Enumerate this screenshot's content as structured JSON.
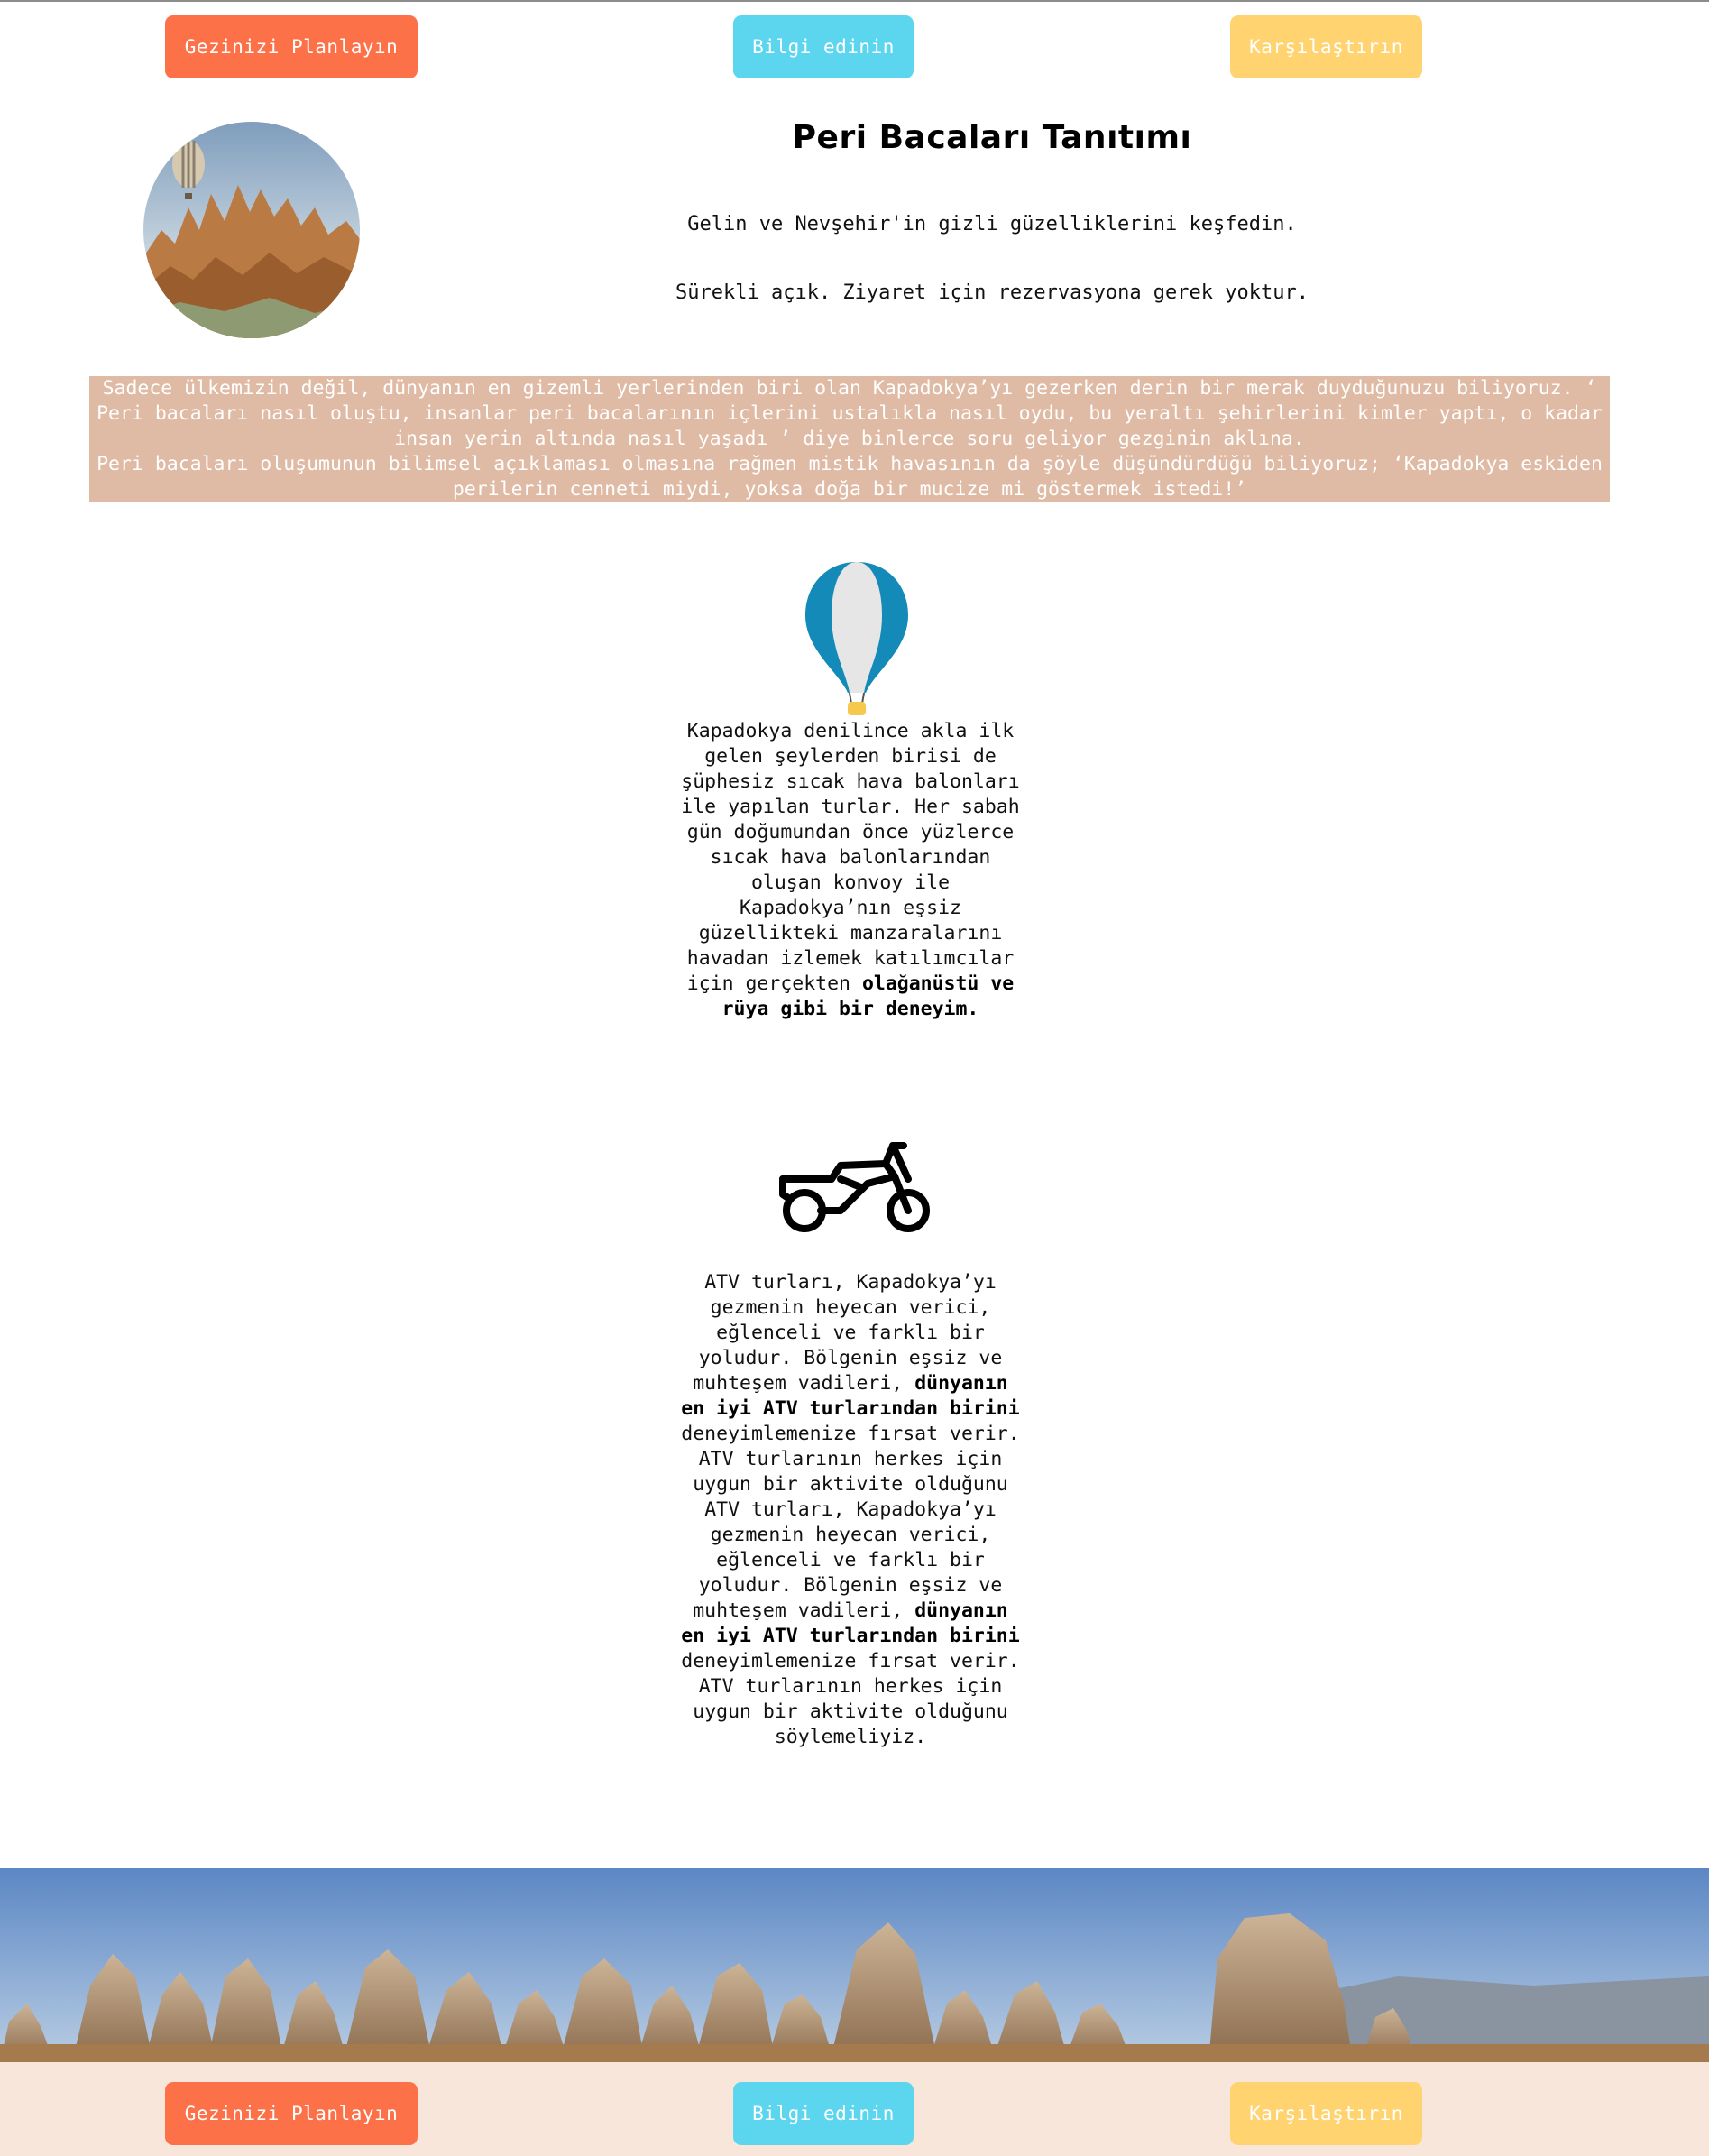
{
  "nav": {
    "plan_label": "Gezinizi Planlayın",
    "info_label": "Bilgi edinin",
    "compare_label": "Karşılaştırın"
  },
  "header": {
    "title": "Peri Bacaları Tanıtımı",
    "subtitle_1": "Gelin ve Nevşehir'in gizli güzelliklerini keşfedin.",
    "subtitle_2": "Sürekli açık. Ziyaret için rezervasyona gerek yoktur."
  },
  "intro": {
    "paragraph_1": "Sadece ülkemizin değil, dünyanın en gizemli yerlerinden biri olan Kapadokya’yı gezerken derin bir merak duyduğunuzu biliyoruz. ‘ Peri bacaları nasıl oluştu, insanlar peri bacalarının içlerini ustalıkla nasıl oydu, bu yeraltı şehirlerini kimler yaptı, o kadar insan yerin altında nasıl yaşadı ’ diye binlerce soru geliyor gezginin aklına.",
    "paragraph_2": "Peri bacaları oluşumunun bilimsel açıklaması olmasına rağmen mistik havasının da şöyle düşündürdüğü biliyoruz; ‘Kapadokya eskiden perilerin cenneti miydi, yoksa doğa bir mucize mi göstermek istedi!’"
  },
  "features": [
    {
      "icon": "hot-air-balloon-icon",
      "text": "Kapadokya denilince akla ilk gelen şeylerden birisi de şüphesiz sıcak hava balonları ile yapılan turlar. Her sabah gün doğumundan önce yüzlerce sıcak hava balonlarından oluşan konvoy ile Kapadokya’nın eşsiz güzellikteki manzaralarını havadan izlemek katılımcılar için gerçekten ",
      "bold": "olağanüstü ve rüya gibi bir deneyim."
    },
    {
      "icon": "motorcycle-icon",
      "text_a": "ATV turları, Kapadokya’yı gezmenin heyecan verici, eğlenceli ve farklı bir yoludur. Bölgenin eşsiz ve muhteşem vadileri, ",
      "bold_a": "dünyanın en iyi ATV turlarından birini",
      "text_b": " deneyimlemenize fırsat verir. ATV turlarının herkes için uygun bir aktivite olduğunu",
      "text_c": "ATV turları, Kapadokya’yı gezmenin heyecan verici, eğlenceli ve farklı bir yoludur. Bölgenin eşsiz ve muhteşem vadileri, ",
      "bold_c": "dünyanın en iyi ATV turlarından birini",
      "text_d": " deneyimlemenize fırsat verir. ATV turlarının herkes için uygun bir aktivite olduğunu söylemeliyiz."
    }
  ],
  "colors": {
    "plan": "#fd7149",
    "info": "#5cd5ee",
    "compare": "#ffd470",
    "intro_bg": "#dfbaa4",
    "footer_bg": "#f8e6da"
  }
}
